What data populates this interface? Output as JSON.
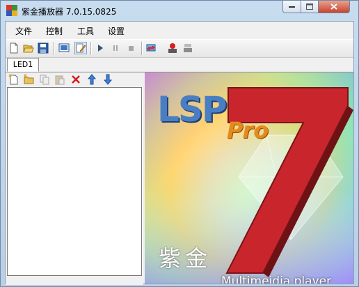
{
  "window": {
    "title": "紫金播放器 7.0.15.0825"
  },
  "menu": {
    "items": [
      "文件",
      "控制",
      "工具",
      "设置"
    ]
  },
  "tabs": [
    {
      "label": "LED1"
    }
  ],
  "banner": {
    "brand": "LSP",
    "edition": "Pro",
    "version": "7",
    "logo_chars": "紫金",
    "tagline": "Multimeidia player"
  },
  "colors": {
    "title_blue": "#4a7ec2",
    "pro_orange": "#e58a1d",
    "seven_red": "#c8262c"
  },
  "icons": {
    "toolbar": [
      "new-file-icon",
      "open-folder-icon",
      "save-icon",
      "display-window-icon",
      "edit-icon",
      "play-icon",
      "pause-icon",
      "stop-icon",
      "sync-icon",
      "record-icon",
      "transmit-icon"
    ],
    "list_toolbar": [
      "new-item-icon",
      "new-folder-icon",
      "copy-icon",
      "paste-icon",
      "delete-icon",
      "move-up-icon",
      "move-down-icon"
    ]
  }
}
